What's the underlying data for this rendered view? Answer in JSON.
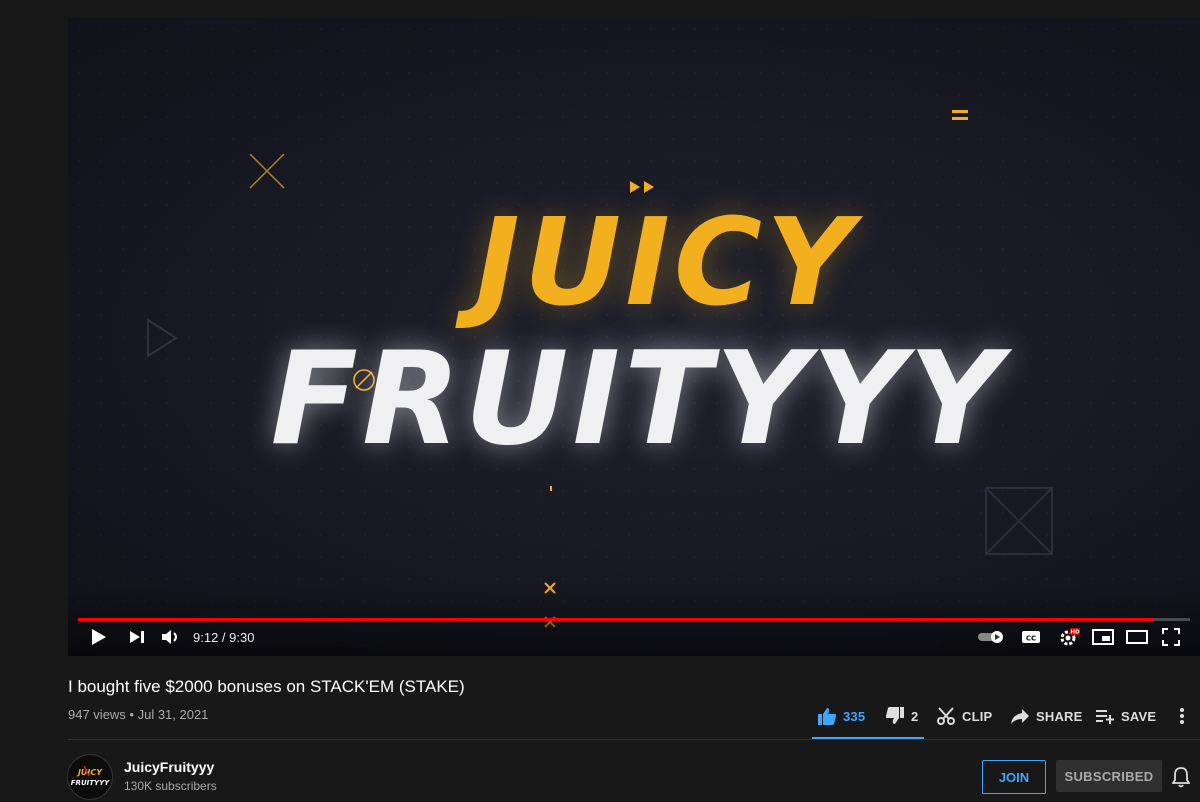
{
  "video": {
    "overlay_line1": "JUICY",
    "overlay_line2": "FRUITYYY",
    "time_display": "9:12 / 9:30",
    "progress": 0.968,
    "hd_badge": "HD"
  },
  "info": {
    "title": "I bought five $2000 bonuses on STACK'EM (STAKE)",
    "meta": "947 views • Jul 31, 2021"
  },
  "actions": {
    "likes": "335",
    "dislikes": "2",
    "clip": "CLIP",
    "share": "SHARE",
    "save": "SAVE"
  },
  "channel": {
    "name": "JuicyFruityyy",
    "subscribers": "130K subscribers",
    "avatar_text": "JUICY FRUITYYY",
    "join_label": "JOIN",
    "subscribed_label": "SUBSCRIBED"
  },
  "colors": {
    "accent_blue": "#3ea6ff",
    "progress_red": "#ff0000",
    "brand_gold": "#f2b01e"
  },
  "icons": [
    "play-icon",
    "next-icon",
    "volume-icon",
    "autoplay-toggle-icon",
    "captions-icon",
    "settings-icon",
    "miniplayer-icon",
    "theater-icon",
    "fullscreen-icon",
    "like-icon",
    "dislike-icon",
    "scissors-icon",
    "share-icon",
    "save-playlist-icon",
    "more-icon",
    "bell-icon"
  ]
}
